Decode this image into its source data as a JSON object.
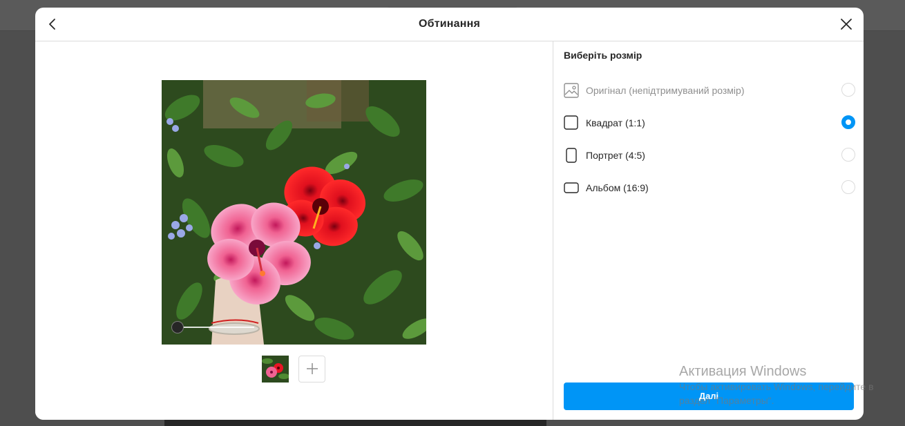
{
  "dialog": {
    "title": "Обтинання",
    "back_icon": "chevron-left-icon",
    "close_icon": "close-icon"
  },
  "editor": {
    "photo_description": "hibiscus-photo",
    "zoom_level": 0,
    "thumbnails_count": 1
  },
  "crop_panel": {
    "heading": "Виберіть розмір",
    "options": [
      {
        "label": "Оригінал (непідтримуваний розмір)",
        "icon": "image-icon",
        "selected": false,
        "disabled": true
      },
      {
        "label": "Квадрат (1:1)",
        "icon": "square-icon",
        "selected": true,
        "disabled": false
      },
      {
        "label": "Портрет (4:5)",
        "icon": "portrait-icon",
        "selected": false,
        "disabled": false
      },
      {
        "label": "Альбом (16:9)",
        "icon": "landscape-icon",
        "selected": false,
        "disabled": false
      }
    ],
    "next_label": "Далі"
  },
  "watermark": {
    "title": "Активация Windows",
    "text": "Чтобы активировать Windows, перейдите в раздел \"Параметры\"."
  },
  "colors": {
    "accent": "#0095f6",
    "border": "#dbdbdb",
    "text": "#262626",
    "muted": "#8e8e8e"
  }
}
